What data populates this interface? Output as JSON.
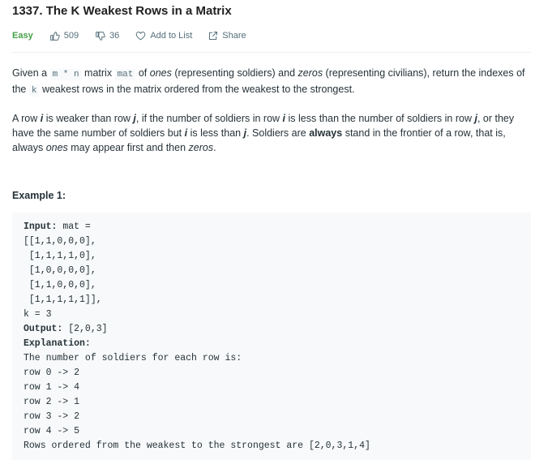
{
  "problem": {
    "title": "1337. The K Weakest Rows in a Matrix",
    "difficulty": "Easy",
    "likes": "509",
    "dislikes": "36",
    "add_to_list": "Add to List",
    "share": "Share"
  },
  "description": {
    "p1": {
      "t1": "Given a ",
      "c1": "m * n",
      "t2": " matrix ",
      "c2": "mat",
      "t3": " of ",
      "e1": "ones",
      "t4": " (representing soldiers) and ",
      "e2": "zeros",
      "t5": " (representing civilians), return the indexes of the ",
      "c3": "k",
      "t6": " weakest rows in the matrix ordered from the weakest to the strongest."
    },
    "p2": {
      "t1": "A row ",
      "v1": "i",
      "t2": " is weaker than row ",
      "v2": "j",
      "t3": ", if the number of soldiers in row ",
      "v3": "i",
      "t4": " is less than the number of soldiers in row ",
      "v4": "j",
      "t5": ", or they have the same number of soldiers but ",
      "v5": "i",
      "t6": " is less than ",
      "v6": "j",
      "t7": ". Soldiers are ",
      "b1": "always",
      "t8": " stand in the frontier of a row, that is, always ",
      "e1": "ones",
      "t9": " may appear first and then ",
      "e2": "zeros",
      "t10": "."
    }
  },
  "example1": {
    "title": "Example 1:",
    "input_label": "Input:",
    "input_value": " mat = \n[[1,1,0,0,0],\n [1,1,1,1,0],\n [1,0,0,0,0],\n [1,1,0,0,0],\n [1,1,1,1,1]], \nk = 3",
    "output_label": "Output:",
    "output_value": " [2,0,3]",
    "explanation_label": "Explanation:",
    "explanation_value": "The number of soldiers for each row is: \nrow 0 -> 2 \nrow 1 -> 4 \nrow 2 -> 1 \nrow 3 -> 2 \nrow 4 -> 5 \nRows ordered from the weakest to the strongest are [2,0,3,1,4]"
  },
  "colors": {
    "difficulty_easy": "#43a047",
    "meta_text": "#546e7a",
    "code_bg": "#f7f9fa"
  }
}
